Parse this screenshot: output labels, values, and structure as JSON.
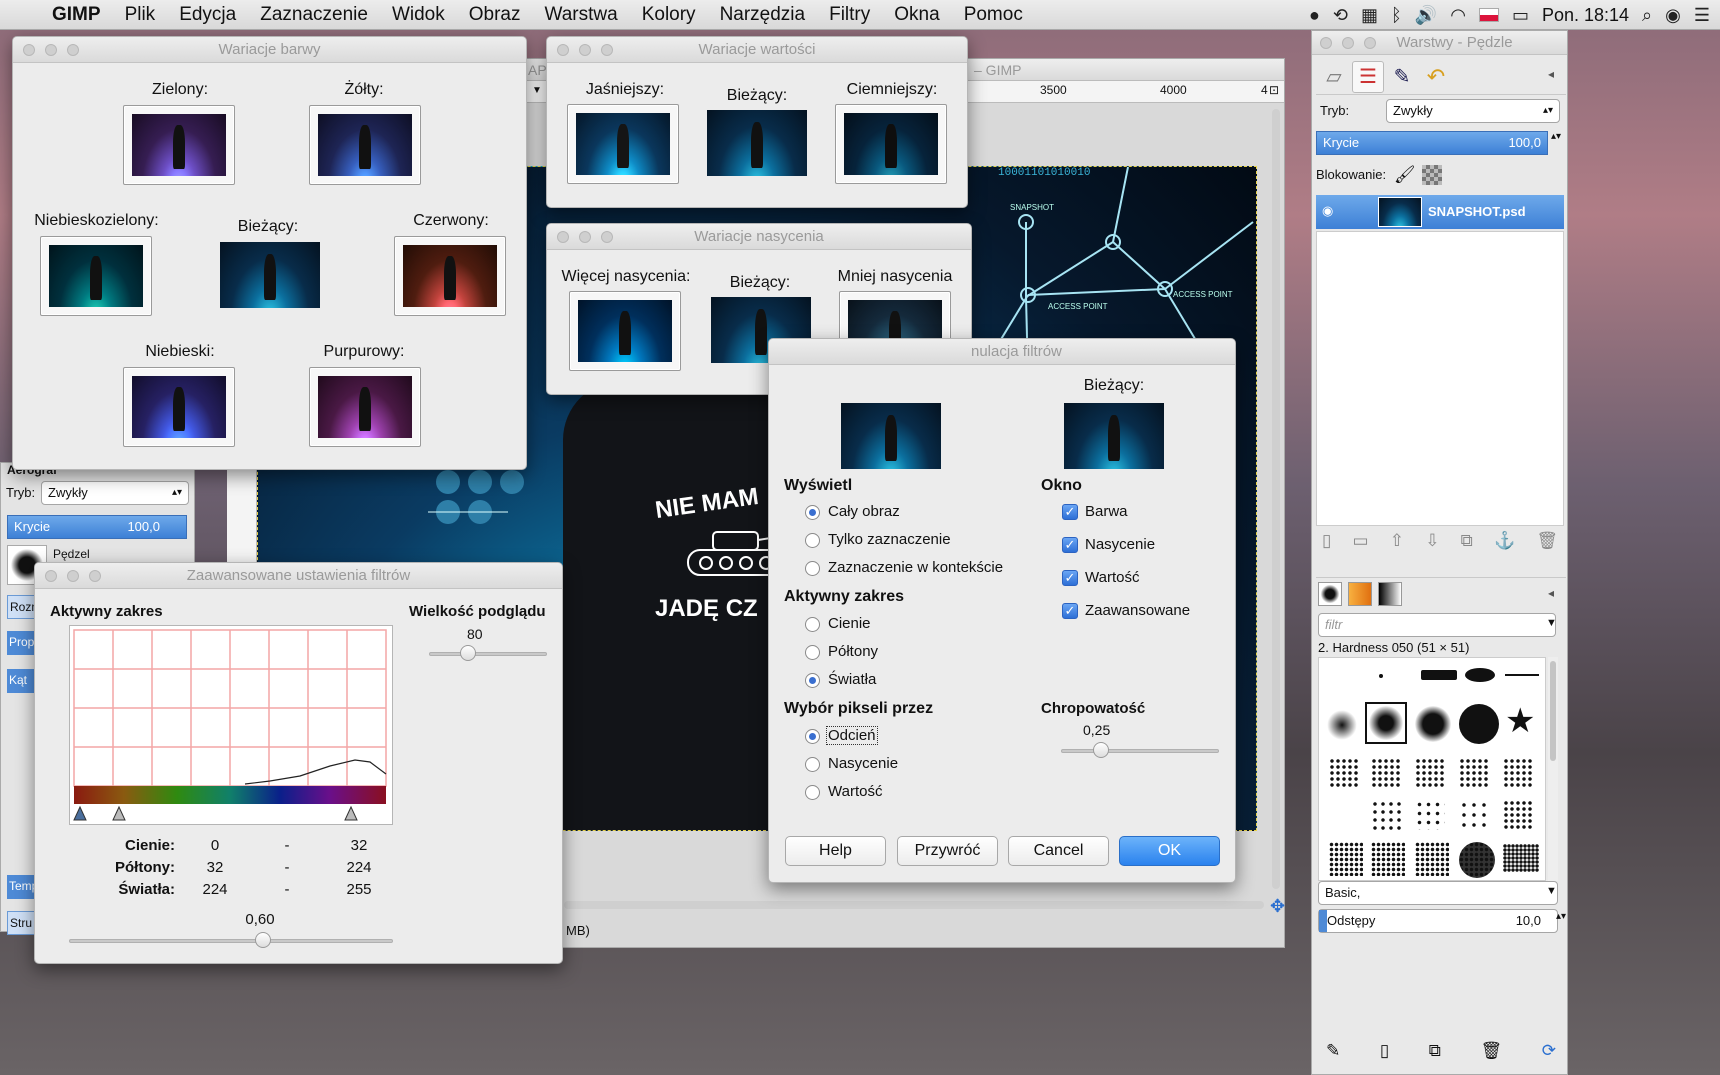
{
  "menubar": {
    "app": "GIMP",
    "items": [
      "Plik",
      "Edycja",
      "Zaznaczenie",
      "Widok",
      "Obraz",
      "Warstwa",
      "Kolory",
      "Narzędzia",
      "Filtry",
      "Okna",
      "Pomoc"
    ],
    "clock": "Pon. 18:14",
    "status_icons": [
      "record-icon",
      "time-machine-icon",
      "keyboard-icon",
      "bluetooth-icon",
      "volume-icon",
      "wifi-icon",
      "flag-pl-icon",
      "battery-icon",
      "search-icon",
      "user-icon",
      "list-icon"
    ]
  },
  "image_window": {
    "title": "– GIMP",
    "title_prefix": "AP",
    "ruler_3500": "3500",
    "ruler_4000": "4000",
    "ruler_end": "4",
    "status_partial": "MB)",
    "shirt_line1": "NIE MAM",
    "shirt_line2": "JADĘ CZ",
    "canvas_text_1": "SNAPSHOT",
    "canvas_text_2": "ACCESS POINT",
    "canvas_text_3": "ACCESS POINT",
    "canvas_binary": "10001101010010"
  },
  "hue_variations": {
    "title": "Wariacje barwy",
    "green": "Zielony:",
    "yellow": "Żółty:",
    "cyan": "Niebieskozielony:",
    "current": "Bieżący:",
    "red": "Czerwony:",
    "blue": "Niebieski:",
    "magenta": "Purpurowy:"
  },
  "value_variations": {
    "title": "Wariacje wartości",
    "lighter": "Jaśniejszy:",
    "current": "Bieżący:",
    "darker": "Ciemniejszy:"
  },
  "saturation_variations": {
    "title": "Wariacje nasycenia",
    "more": "Więcej nasycenia:",
    "current": "Bieżący:",
    "less": "Mniej nasycenia"
  },
  "filter_pack": {
    "title_partial": "nulacja filtrów",
    "current": "Bieżący:",
    "show_heading": "Wyświetl",
    "show_options": [
      "Cały obraz",
      "Tylko zaznaczenie",
      "Zaznaczenie w kontekście"
    ],
    "show_selected": 0,
    "window_heading": "Okno",
    "window_options": [
      "Barwa",
      "Nasycenie",
      "Wartość",
      "Zaawansowane"
    ],
    "range_heading": "Aktywny zakres",
    "range_options": [
      "Cienie",
      "Półtony",
      "Światła"
    ],
    "range_selected": 2,
    "select_heading": "Wybór pikseli przez",
    "select_options": [
      "Odcień",
      "Nasycenie",
      "Wartość"
    ],
    "select_selected": 0,
    "roughness_heading": "Chropowatość",
    "roughness_value": "0,25",
    "roughness": 0.25,
    "buttons": {
      "help": "Help",
      "reset": "Przywróć",
      "cancel": "Cancel",
      "ok": "OK"
    }
  },
  "advanced": {
    "title": "Zaawansowane ustawienia filtrów",
    "active_range": "Aktywny zakres",
    "preview_size_label": "Wielkość podglądu",
    "preview_size_value": "80",
    "preview_size": 0.33,
    "rows": [
      {
        "name": "Cienie:",
        "from": "0",
        "dash": "-",
        "to": "32"
      },
      {
        "name": "Półtony:",
        "from": "32",
        "dash": "-",
        "to": "224"
      },
      {
        "name": "Światła:",
        "from": "224",
        "dash": "-",
        "to": "255"
      }
    ],
    "gamma_value": "0,60",
    "gamma": 0.6
  },
  "toolbox": {
    "tool_name": "Aerograf",
    "mode_label": "Tryb:",
    "mode_value": "Zwykły",
    "opacity_label": "Krycie",
    "opacity_value": "100,0",
    "brush_label": "Pędzel",
    "size_label": "Rozm",
    "ratio_label": "Prop",
    "angle_label": "Kąt",
    "temp_label": "Temp",
    "stroke_label": "Stru"
  },
  "layers_dock": {
    "title": "Warstwy - Pędzle",
    "mode_label": "Tryb:",
    "mode_value": "Zwykły",
    "opacity_label": "Krycie",
    "opacity_value": "100,0",
    "lock_label": "Blokowanie:",
    "layer_name": "SNAPSHOT.psd",
    "filter_placeholder": "filtr",
    "brush_name": "2. Hardness 050 (51 × 51)",
    "tag_value": "Basic,",
    "spacing_label": "Odstępy",
    "spacing_value": "10,0"
  }
}
